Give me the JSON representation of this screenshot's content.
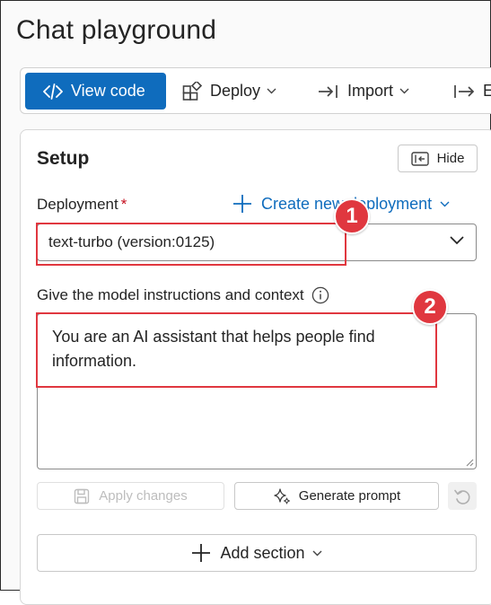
{
  "page": {
    "title": "Chat playground"
  },
  "toolbar": {
    "view_code_label": "View code",
    "deploy_label": "Deploy",
    "import_label": "Import",
    "export_label": "E"
  },
  "setup": {
    "title": "Setup",
    "hide_label": "Hide",
    "deployment_label": "Deployment",
    "required_mark": "*",
    "create_link_label": "Create new deployment",
    "selected_deployment": "text-turbo (version:0125)",
    "instructions_label": "Give the model instructions and context",
    "instructions_value": "You are an AI assistant that helps people find information.",
    "apply_label": "Apply changes",
    "generate_label": "Generate prompt",
    "add_section_label": "Add section"
  },
  "annotations": {
    "badge_1": "1",
    "badge_2": "2"
  },
  "colors": {
    "accent": "#0f6cbd",
    "annotation_red": "#e0373f",
    "required_red": "#c50f1f"
  },
  "icons": {
    "view_code": "code-icon",
    "deploy": "cube-icon",
    "import": "arrow-into-bar-icon",
    "export": "arrow-right-bar-icon",
    "hide": "panel-collapse-icon",
    "create": "plus-icon",
    "info": "info-icon",
    "apply": "save-icon",
    "generate": "sparkle-icon",
    "reset": "undo-icon",
    "add_section": "plus-icon"
  }
}
